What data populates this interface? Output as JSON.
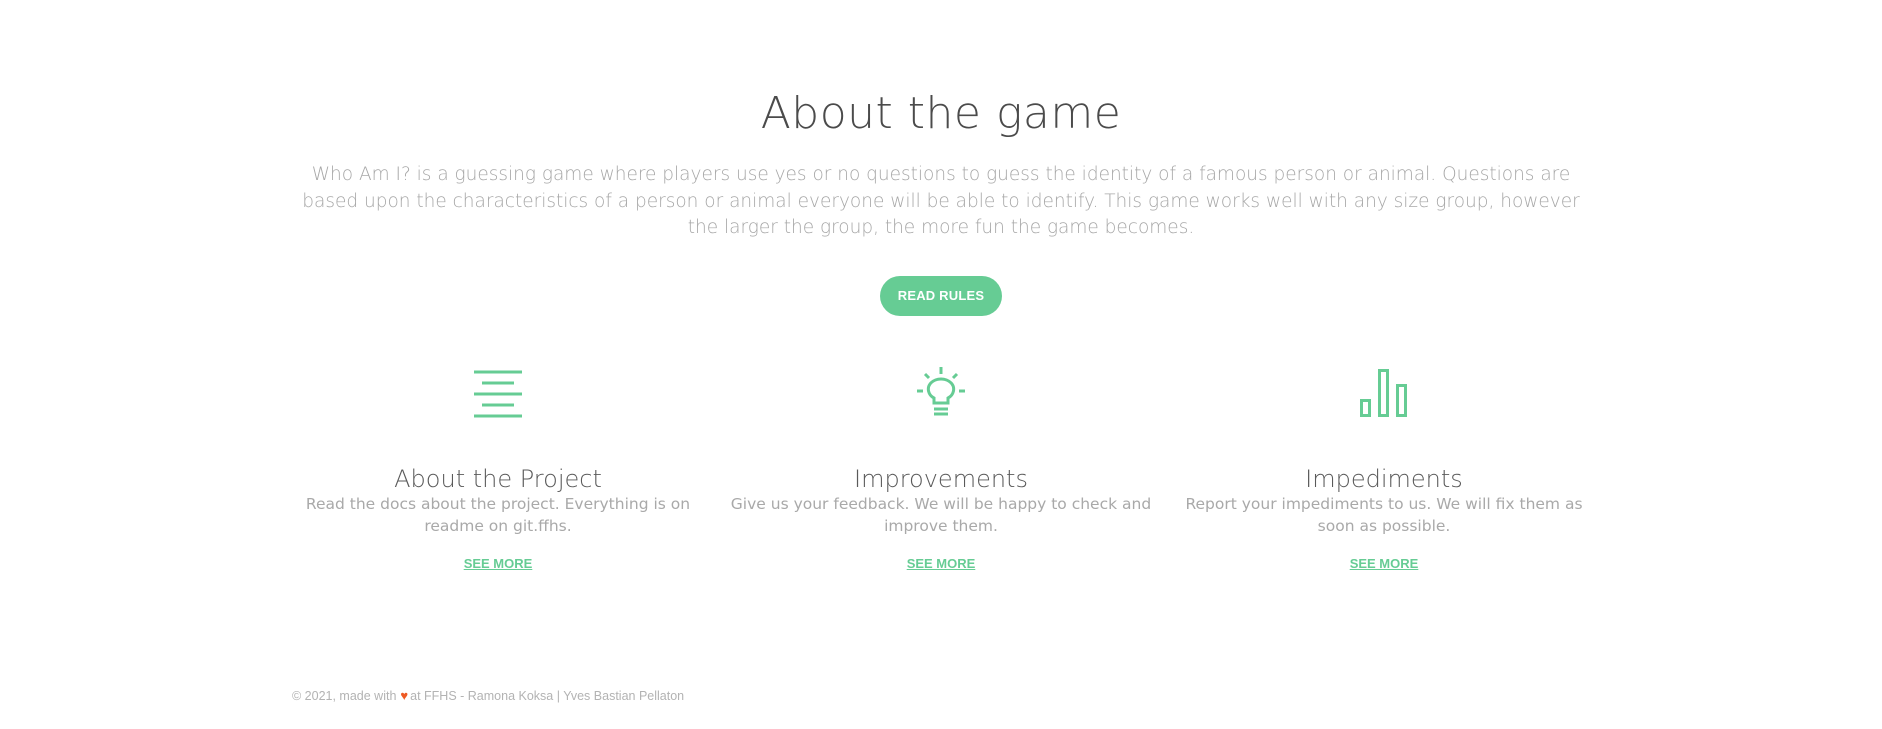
{
  "about": {
    "title": "About the game",
    "intro": "Who Am I? is a guessing game where players use yes or no questions to guess the identity of a famous person or animal. Questions are based upon the characteristics of a person or animal everyone will be able to identify. This game works well with any size group, however the larger the group, the more fun the game becomes.",
    "button_label": "READ RULES"
  },
  "features": [
    {
      "icon": "text-align-icon",
      "title": "About the Project",
      "description": "Read the docs about the project. Everything is on readme on git.ffhs.",
      "link_label": "SEE MORE"
    },
    {
      "icon": "lightbulb-icon",
      "title": "Improvements",
      "description": "Give us your feedback. We will be happy to check and improve them.",
      "link_label": "SEE MORE"
    },
    {
      "icon": "bar-chart-icon",
      "title": "Impediments",
      "description": "Report your impediments to us. We will fix them as soon as possible.",
      "link_label": "SEE MORE"
    }
  ],
  "footer": {
    "prefix": "© 2021, made with",
    "heart_icon": "heart-icon",
    "suffix": "at FFHS - Ramona Koksa | Yves Bastian Pellaton"
  },
  "colors": {
    "accent": "#66cc94",
    "heart": "#ee5a24",
    "title_text": "#4b4b4b",
    "body_text": "#a7a7a7"
  }
}
